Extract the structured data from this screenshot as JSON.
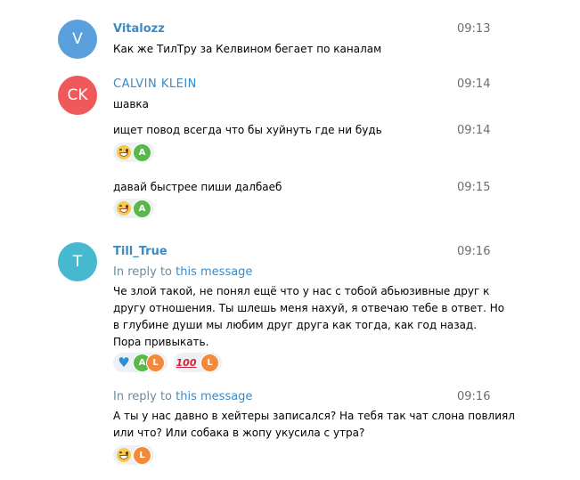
{
  "messages": [
    {
      "avatar_initial": "V",
      "avatar_color": "#5aa0dc",
      "name": "Vitalozz",
      "name_color": "#3a8ac4",
      "time": "09:13",
      "text": "Как же ТилТру за Келвином бегает по каналам"
    },
    {
      "avatar_initial": "CK",
      "avatar_color": "#ef5959",
      "name": "CALVIN KLEIN",
      "name_color": "#3a8ac4",
      "time": "09:14",
      "text": "шавка"
    },
    {
      "time": "09:14",
      "text": "ищет повод всегда что бы хуйнуть где ни будь",
      "reactions": [
        {
          "emoji": "grin-icon",
          "users": [
            "A"
          ]
        }
      ]
    },
    {
      "time": "09:15",
      "text": "давай быстрее пиши далбаеб",
      "reactions": [
        {
          "emoji": "grin-icon",
          "users": [
            "A"
          ]
        }
      ]
    },
    {
      "avatar_initial": "T",
      "avatar_color": "#46b8d0",
      "name": "Till_True",
      "name_color": "#3a8ac4",
      "time": "09:16",
      "reply_prefix": "In reply to",
      "reply_link": "this message",
      "text_lines": [
        "Че злой такой, не понял ещё что у нас с тобой абьюзивные друг к",
        "другу отношения. Ты шлешь меня нахуй, я отвечаю тебе в ответ. Но",
        "в глубине души мы любим друг друга как тогда, как год назад.",
        "Пора привыкать."
      ],
      "reactions": [
        {
          "emoji": "blue-heart-icon",
          "users": [
            "A",
            "L"
          ]
        },
        {
          "emoji": "hundred-icon",
          "symbol": "100",
          "users": [
            "L"
          ]
        }
      ]
    },
    {
      "time": "09:16",
      "reply_prefix": "In reply to",
      "reply_link": "this message",
      "text_lines": [
        "А ты у нас давно в хейтеры записался? На тебя так чат слона повлиял",
        "или что? Или собака в жопу укусила с утра?"
      ],
      "reactions": [
        {
          "emoji": "grin-icon",
          "users": [
            "L"
          ]
        }
      ]
    }
  ],
  "colors": {
    "user_A": "#59b84a",
    "user_L": "#f28a3c",
    "time": "#6d6d6d",
    "link": "#3a8ac4"
  }
}
